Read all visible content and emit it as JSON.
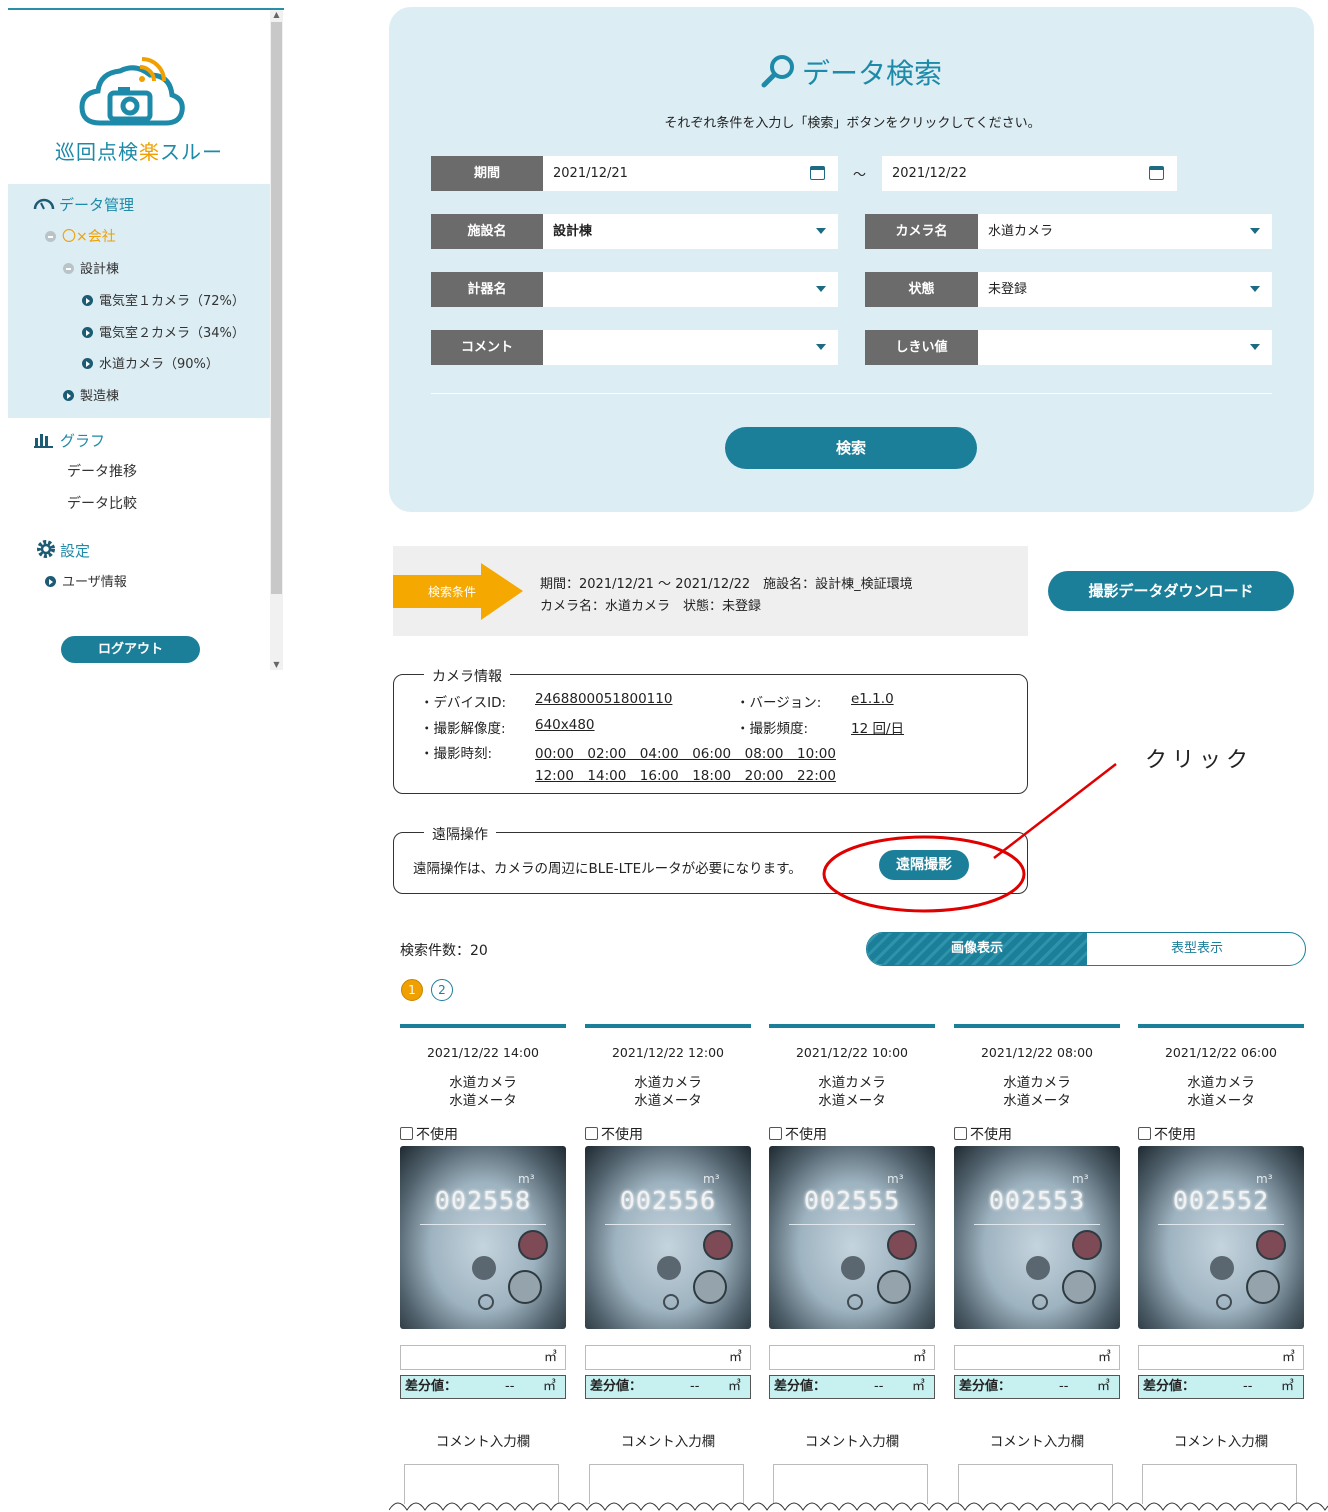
{
  "sidebar": {
    "logo_text_pre": "巡回点検",
    "logo_text_accent": "楽",
    "logo_text_post": "スルー",
    "data_mgmt": "データ管理",
    "company": "〇×会社",
    "building1": "設計棟",
    "cam1": "電気室１カメラ（72%）",
    "cam2": "電気室２カメラ（34%）",
    "cam3": "水道カメラ（90%）",
    "building2": "製造棟",
    "graph": "グラフ",
    "trend": "データ推移",
    "compare": "データ比較",
    "settings": "設定",
    "user_info": "ユーザ情報",
    "logout": "ログアウト"
  },
  "search_panel": {
    "title": "データ検索",
    "desc": "それぞれ条件を入力し「検索」ボタンをクリックしてください。",
    "period_label": "期間",
    "date_from": "2021/12/21",
    "tilde": "～",
    "date_to": "2021/12/22",
    "facility_label": "施設名",
    "facility_value": "設計棟",
    "camera_label": "カメラ名",
    "camera_value": "水道カメラ",
    "meter_label": "計器名",
    "meter_value": "",
    "status_label": "状態",
    "status_value": "未登録",
    "comment_label": "コメント",
    "comment_value": "",
    "threshold_label": "しきい値",
    "threshold_value": "",
    "search_button": "検索"
  },
  "conditions": {
    "tag": "検索条件",
    "line1": "期間：2021/12/21 ～ 2021/12/22　施設名：設計棟_検証環境",
    "line2": "カメラ名：水道カメラ　状態：未登録",
    "download_button": "撮影データダウンロード"
  },
  "camera_info": {
    "title": "カメラ情報",
    "device_id_label": "・デバイスID:",
    "device_id": "2468800051800110",
    "version_label": "・バージョン:",
    "version": "e1.1.0",
    "resolution_label": "・撮影解像度:",
    "resolution": "640x480",
    "frequency_label": "・撮影頻度:",
    "frequency": "12 回/日",
    "time_label": "・撮影時刻:",
    "times_row1": "00:00　02:00　04:00　06:00　08:00　10:00",
    "times_row2": "12:00　14:00　16:00　18:00　20:00　22:00"
  },
  "remote": {
    "title": "遠隔操作",
    "desc": "遠隔操作は、カメラの周辺にBLE-LTEルータが必要になります。",
    "button": "遠隔撮影",
    "annotation": "クリック"
  },
  "results": {
    "count_text": "検索件数：20",
    "tab_image": "画像表示",
    "tab_table": "表型表示",
    "pages": [
      "1",
      "2"
    ],
    "unit": "㎥",
    "diff_label": "差分値：",
    "diff_value": "--",
    "unused_label": "不使用",
    "comment_label": "コメント入力欄",
    "items": [
      {
        "datetime": "2021/12/22 14:00",
        "camera": "水道カメラ",
        "meter": "水道メータ",
        "reading": "002558"
      },
      {
        "datetime": "2021/12/22 12:00",
        "camera": "水道カメラ",
        "meter": "水道メータ",
        "reading": "002556"
      },
      {
        "datetime": "2021/12/22 10:00",
        "camera": "水道カメラ",
        "meter": "水道メータ",
        "reading": "002555"
      },
      {
        "datetime": "2021/12/22 08:00",
        "camera": "水道カメラ",
        "meter": "水道メータ",
        "reading": "002553"
      },
      {
        "datetime": "2021/12/22 06:00",
        "camera": "水道カメラ",
        "meter": "水道メータ",
        "reading": "002552"
      }
    ]
  },
  "colors": {
    "accent": "#1c7f99",
    "orange": "#f0a000",
    "panel": "#dcedf4",
    "annotation": "#e00000"
  }
}
